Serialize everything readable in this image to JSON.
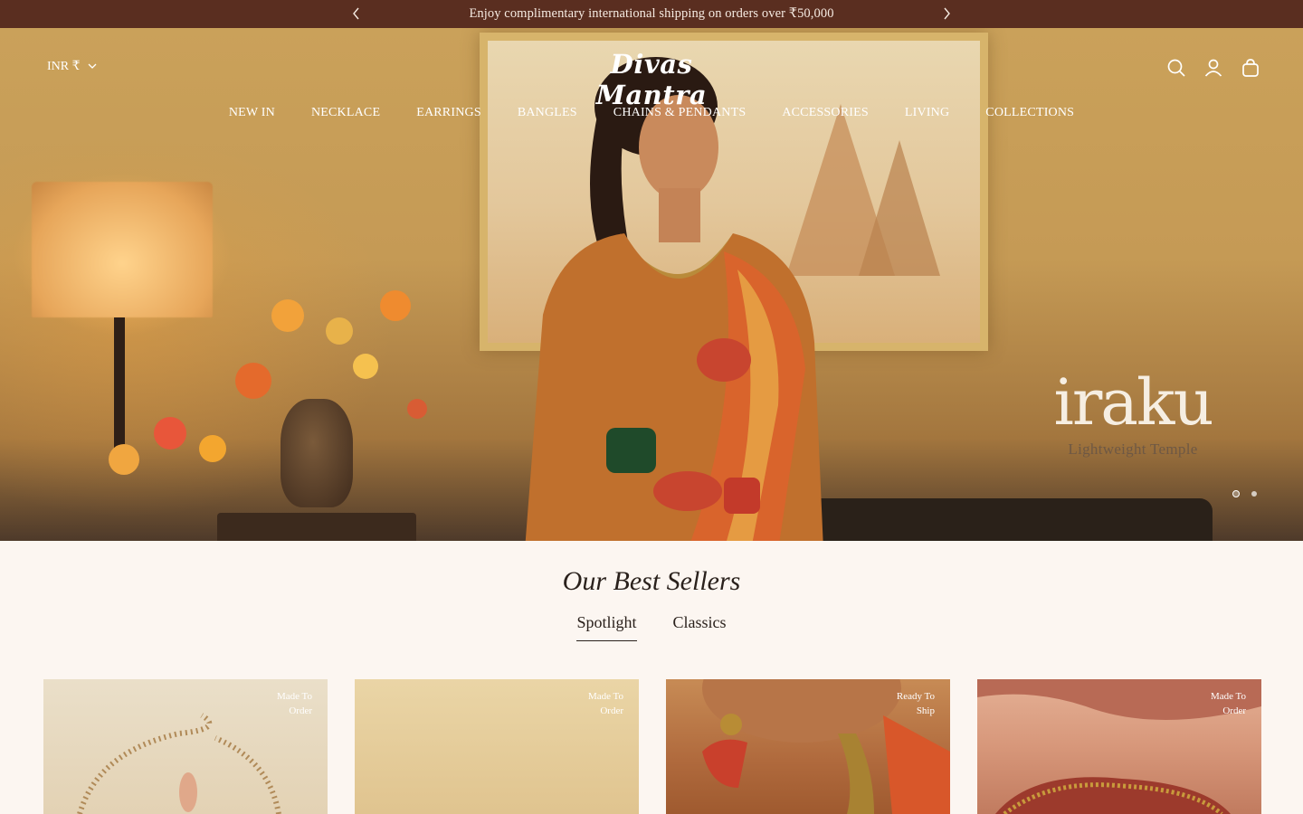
{
  "announcement": {
    "message": "Enjoy complimentary international shipping on orders over ₹50,000"
  },
  "header": {
    "currency": "INR ₹",
    "logo": "Divas Mantra",
    "icons": [
      "search-icon",
      "account-icon",
      "cart-icon"
    ]
  },
  "nav": {
    "items": [
      {
        "label": "NEW IN"
      },
      {
        "label": "NECKLACE"
      },
      {
        "label": "EARRINGS"
      },
      {
        "label": "BANGLES"
      },
      {
        "label": "CHAINS & PENDANTS"
      },
      {
        "label": "ACCESSORIES"
      },
      {
        "label": "LIVING"
      },
      {
        "label": "COLLECTIONS"
      }
    ]
  },
  "hero": {
    "brand_word": "iraku",
    "brand_sub": "Lightweight Temple",
    "slides_total": 2,
    "active_slide": 1
  },
  "best_sellers": {
    "title": "Our Best Sellers",
    "tabs": [
      {
        "label": "Spotlight",
        "active": true
      },
      {
        "label": "Classics",
        "active": false
      }
    ],
    "products": [
      {
        "badge_line1": "Made To",
        "badge_line2": "Order"
      },
      {
        "badge_line1": "Made To",
        "badge_line2": "Order"
      },
      {
        "badge_line1": "Ready To",
        "badge_line2": "Ship"
      },
      {
        "badge_line1": "Made To",
        "badge_line2": "Order"
      }
    ]
  },
  "colors": {
    "announcement_bg": "#5a2e20",
    "page_bg": "#fcf6f1",
    "text": "#2a211c"
  }
}
